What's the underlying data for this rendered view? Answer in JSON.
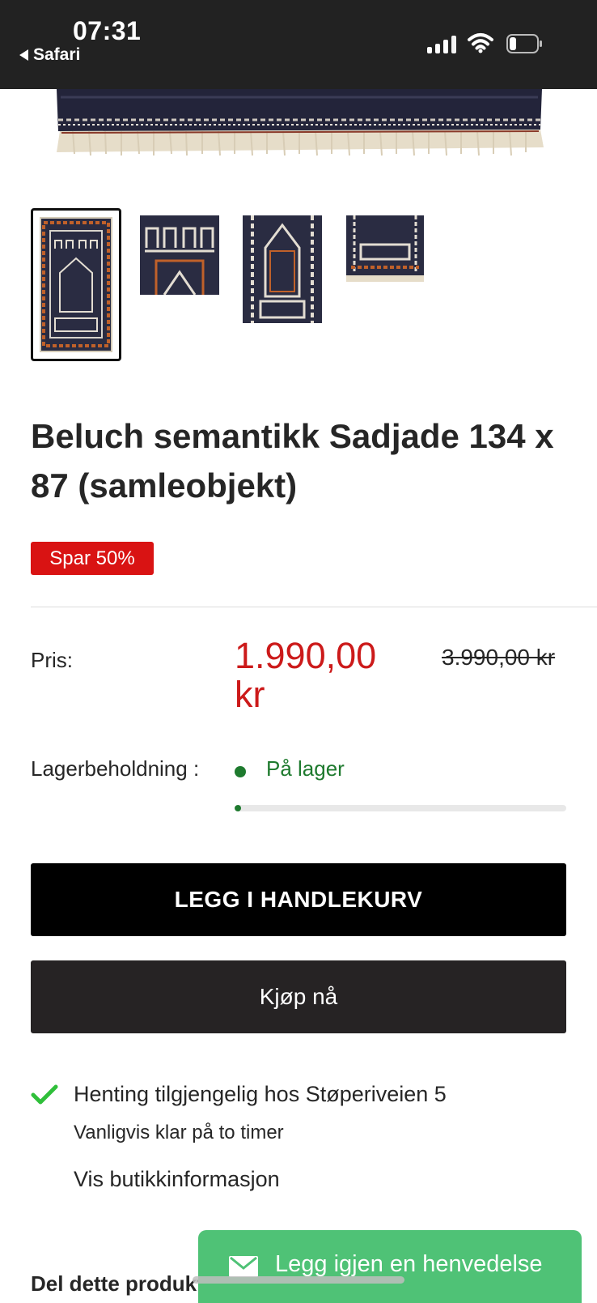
{
  "status_bar": {
    "time": "07:31",
    "back_label": "Safari",
    "icons": [
      "cellular-signal-icon",
      "wifi-icon",
      "battery-icon"
    ]
  },
  "gallery": {
    "thumbnails": [
      {
        "name": "rug-front-view",
        "selected": true
      },
      {
        "name": "rug-top-detail",
        "selected": false
      },
      {
        "name": "rug-center-detail",
        "selected": false
      },
      {
        "name": "rug-bottom-detail",
        "selected": false
      }
    ]
  },
  "product": {
    "title": "Beluch semantikk Sadjade 134 x 87 (samleobjekt)",
    "discount_badge": "Spar 50%",
    "price_label": "Pris:",
    "price_now": "1.990,00 kr",
    "price_old": "3.990,00 kr",
    "stock_label": "Lagerbeholdning :",
    "stock_value": "På lager",
    "stock_level_fraction": 0.02
  },
  "actions": {
    "add_to_cart": "LEGG I HANDLEKURV",
    "buy_now": "Kjøp nå"
  },
  "pickup": {
    "title": "Henting tilgjengelig hos Støperiveien 5",
    "subtitle": "Vanligvis klar på to timer",
    "store_link": "Vis butikkinformasjon"
  },
  "share": {
    "label": "Del dette produkt"
  },
  "contact": {
    "label": "Legg igjen en henvedelse"
  },
  "colors": {
    "sale_red": "#d91313",
    "price_red": "#cc1a1a",
    "stock_green": "#1e7a2e",
    "check_green": "#2fbf3a",
    "contact_green": "#4fc276",
    "status_bar": "#222222"
  }
}
